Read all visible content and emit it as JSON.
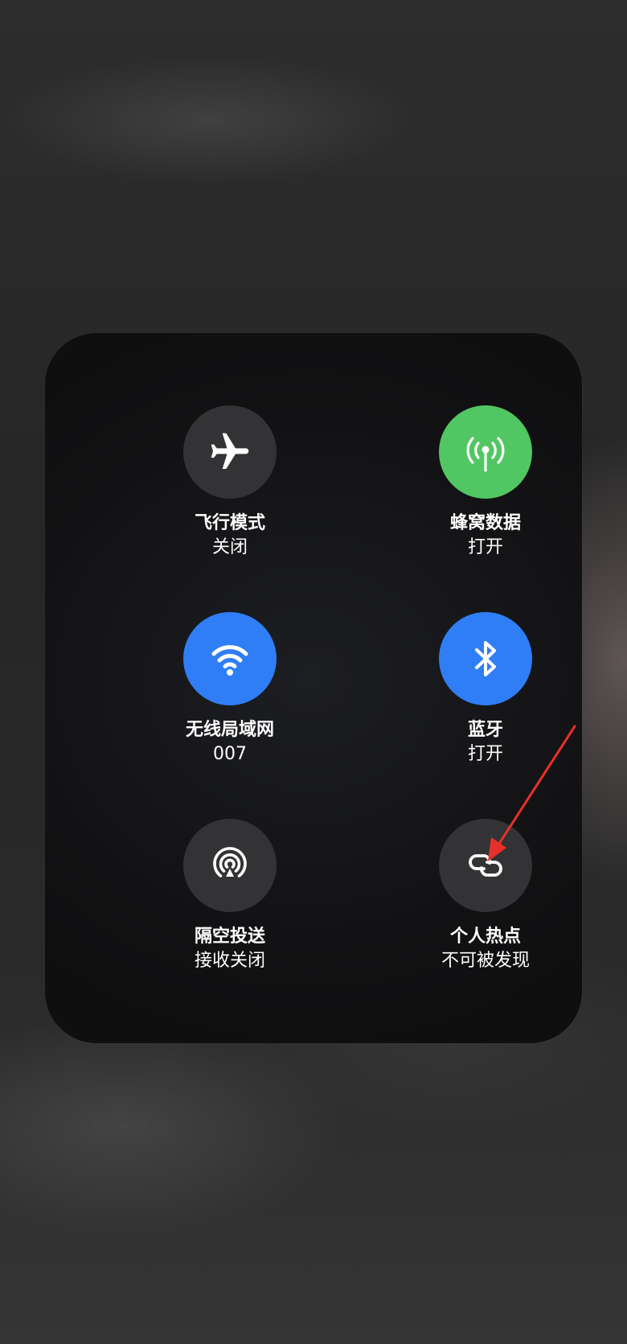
{
  "colors": {
    "off": "#333335",
    "cellular_on": "#52c663",
    "wireless_on": "#2f7ef6",
    "icon": "#ffffff",
    "annotation": "#e8302a"
  },
  "controls": [
    {
      "id": "airplane",
      "title": "飞行模式",
      "status": "关闭",
      "icon": "airplane-icon",
      "state": "off"
    },
    {
      "id": "cellular",
      "title": "蜂窝数据",
      "status": "打开",
      "icon": "antenna-icon",
      "state": "on"
    },
    {
      "id": "wifi",
      "title": "无线局域网",
      "status": "007",
      "icon": "wifi-icon",
      "state": "on"
    },
    {
      "id": "bluetooth",
      "title": "蓝牙",
      "status": "打开",
      "icon": "bluetooth-icon",
      "state": "on"
    },
    {
      "id": "airdrop",
      "title": "隔空投送",
      "status": "接收关闭",
      "icon": "airdrop-icon",
      "state": "off"
    },
    {
      "id": "hotspot",
      "title": "个人热点",
      "status": "不可被发现",
      "icon": "hotspot-link-icon",
      "state": "off"
    }
  ]
}
